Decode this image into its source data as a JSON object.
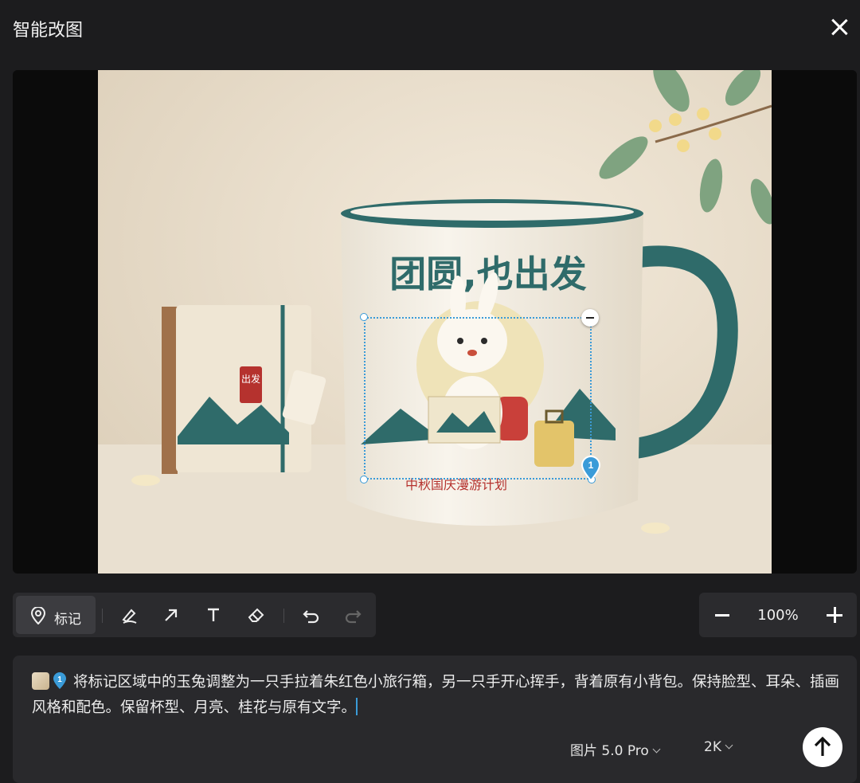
{
  "header": {
    "title": "智能改图"
  },
  "canvas": {
    "mug_text": "团圆,也出发",
    "mug_subtext": "中秋国庆漫游计划",
    "book_stamp": "出发",
    "marker_number": "1"
  },
  "toolbar": {
    "mark_label": "标记",
    "tools": [
      "brush-icon",
      "arrow-icon",
      "text-icon",
      "eraser-icon",
      "undo-icon",
      "redo-icon"
    ]
  },
  "zoom": {
    "value": "100%"
  },
  "prompt": {
    "text": "将标记区域中的玉兔调整为一只手拉着朱红色小旅行箱，另一只手开心挥手，背着原有小背包。保持脸型、耳朵、插画风格和配色。保留杯型、月亮、桂花与原有文字。",
    "model": "图片 5.0 Pro",
    "resolution": "2K"
  },
  "colors": {
    "accent": "#3a9bd8",
    "mug_teal": "#2f6b6a"
  }
}
